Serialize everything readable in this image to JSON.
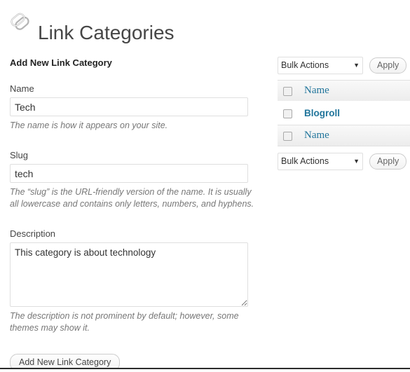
{
  "header": {
    "icon": "chain-link-icon",
    "title": "Link Categories"
  },
  "form": {
    "subtitle": "Add New Link Category",
    "name": {
      "label": "Name",
      "value": "Tech",
      "placeholder": "",
      "help": "The name is how it appears on your site."
    },
    "slug": {
      "label": "Slug",
      "value": "tech",
      "placeholder": "",
      "help": "The “slug” is the URL-friendly version of the name. It is usually all lowercase and contains only letters, numbers, and hyphens."
    },
    "description": {
      "label": "Description",
      "value": "This category is about technology",
      "placeholder": "",
      "help": "The description is not prominent by default; however, some themes may show it."
    },
    "submit_label": "Add New Link Category"
  },
  "tablenav_top": {
    "bulk_actions_selected": "Bulk Actions",
    "caret": "▼",
    "apply_label": "Apply"
  },
  "tablenav_bottom": {
    "bulk_actions_selected": "Bulk Actions",
    "caret": "▼",
    "apply_label": "Apply"
  },
  "table": {
    "header": {
      "select_all": "",
      "name_column": "Name"
    },
    "rows": [
      {
        "name": "Blogroll"
      }
    ],
    "footer": {
      "select_all": "",
      "name_column": "Name"
    }
  },
  "colors": {
    "link": "#21759b",
    "heading": "#464646",
    "helper_text": "#777777",
    "input_border": "#dfdfdf",
    "table_header_bg": "#f1f1f1"
  }
}
